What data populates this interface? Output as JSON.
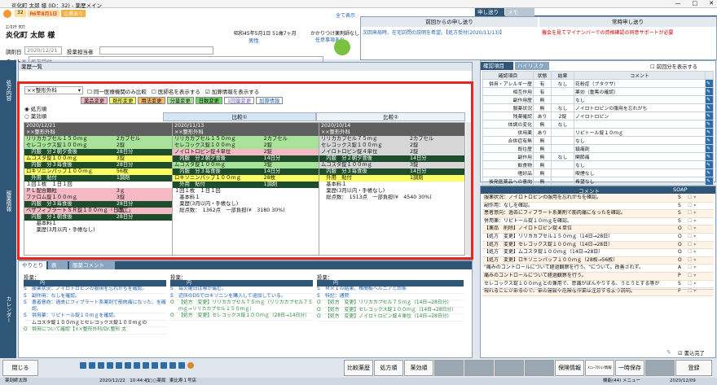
{
  "window": {
    "title": "炎化町 太郎 様 (ID：32) - 薬歴メイン"
  },
  "header": {
    "id": "32",
    "date": "R6年8月1日",
    "badge": "公費あり",
    "kana": "ｴﾝｶﾏﾁ ﾀﾛｳ",
    "name": "炎化町 太郎 様",
    "dob": "昭和45年5月1日 51歳7ヶ月",
    "sex": "男性",
    "shared": "全て表示",
    "reception_date_label": "調剤日",
    "reception_date": "2020/12/21",
    "pharmacist_label": "投薬担当者",
    "title_label": "タイトル",
    "title_value": "処方受付",
    "family_doctor": "かかりつけ薬剤師なし",
    "ref_note": "任意事項あり"
  },
  "top_tabs": {
    "t1": "申し送り",
    "t2": "メモ"
  },
  "handover": {
    "prev_header": "前回からの申し送り",
    "prev_text": "次回来局時、在宅訪問の説明を希望。【処方受付(2020/11/13)】",
    "const_header": "常時申し送り",
    "const_text": "機会を見てマイナンバーでの資格確認の同意サポートが必要"
  },
  "sidebar": [
    "処方内容",
    "服薬情報",
    "カレンダー"
  ],
  "rx": {
    "panel_title": "薬歴一覧",
    "dept": "××整形外科",
    "cb1": "同一医療機関のみ比較",
    "cb2": "医師名を表示する",
    "cb3": "加算情報を表示する",
    "badges": [
      "薬品変更",
      "剤形変更",
      "用法変更",
      "分量変更",
      "日数変更",
      "1回量変更",
      "加算情報"
    ],
    "radio1": "処方順",
    "radio2": "薬効順",
    "compare1": "比較①",
    "compare2": "比較②"
  },
  "cols": [
    {
      "date": "2020/12/21",
      "clinic": "××整形外科",
      "rows": [
        {
          "c": "g",
          "t": "リリカカプセル１５０ｍｇ",
          "q": "2カプセル"
        },
        {
          "c": "g",
          "t": "セレコックス錠１００ｍｇ",
          "q": "2錠"
        },
        {
          "c": "dg",
          "t": "　内服　分２朝夕食後",
          "q": "28日分"
        },
        {
          "c": "y",
          "t": "ムコスタ錠１００ｍｇ",
          "q": "3錠"
        },
        {
          "c": "dg",
          "t": "　内服　分３毎食後",
          "q": "28日分"
        },
        {
          "c": "y",
          "t": "ロキソニンパップ１００ｍｇ",
          "q": "56枚"
        },
        {
          "c": "dg",
          "t": "　外用　貼付",
          "q": "1調剤"
        },
        {
          "c": "w",
          "t": "１回１枚　１日１回",
          "q": ""
        },
        {
          "c": "p",
          "t": "ＰＬ配合顆粒",
          "q": "3ｇ"
        },
        {
          "c": "p",
          "t": "ファロム錠１００ｍｇ",
          "q": "3錠"
        },
        {
          "c": "dg",
          "t": "　内服　分３毎食後",
          "q": "28日分"
        },
        {
          "c": "p",
          "t": "ベザフィブラートＳＲ錠１００ｍｇ「日医工」",
          "q": "1錠"
        },
        {
          "c": "dg",
          "t": "　内服　分１朝食後",
          "q": "28日分"
        },
        {
          "c": "w",
          "t": "　　基本料１",
          "q": ""
        },
        {
          "c": "w",
          "t": "　　薬歴(3月以内・手帳なし)",
          "q": ""
        }
      ]
    },
    {
      "date": "2020/11/13",
      "clinic": "××整形外科",
      "rows": [
        {
          "c": "g",
          "t": "リリカカプセル１５０ｍｇ",
          "q": "2カプセル"
        },
        {
          "c": "g",
          "t": "セレコックス錠１００ｍｇ",
          "q": "2錠"
        },
        {
          "c": "p",
          "t": "ノイロトロピン錠４単位",
          "q": "2錠"
        },
        {
          "c": "dg",
          "t": "　内服　分２朝夕食後",
          "q": "14日分"
        },
        {
          "c": "g",
          "t": "ムコスタ錠１００ｍｇ",
          "q": "3錠"
        },
        {
          "c": "dg",
          "t": "　内服　分３毎食後",
          "q": "14日分"
        },
        {
          "c": "y",
          "t": "ロキソニンパップ１００ｍｇ",
          "q": "28枚"
        },
        {
          "c": "dg",
          "t": "　外用　貼付",
          "q": "1調剤"
        },
        {
          "c": "w",
          "t": "１回１枚　１日１回",
          "q": ""
        },
        {
          "c": "w",
          "t": "　基本料１",
          "q": ""
        },
        {
          "c": "w",
          "t": "　薬歴(3月以内・手帳なし)",
          "q": ""
        },
        {
          "c": "w",
          "t": "　総点数：　1362点　一部負担(¥　3180 30%)",
          "q": ""
        }
      ]
    },
    {
      "date": "2020/10/14",
      "clinic": "××整形外科",
      "rows": [
        {
          "c": "gy",
          "t": "リリカカプセル７５ｍｇ",
          "q": "2カプセル"
        },
        {
          "c": "gy",
          "t": "セレコックス錠１００ｍｇ",
          "q": "2錠"
        },
        {
          "c": "gy",
          "t": "ノイロトロピン錠４単位",
          "q": "2錠"
        },
        {
          "c": "dg",
          "t": "　内服　分２朝夕食後",
          "q": "14日分"
        },
        {
          "c": "gy",
          "t": "ムコスタ錠１００ｍｇ",
          "q": "3錠"
        },
        {
          "c": "dg",
          "t": "　内服　分３毎食後",
          "q": "14日分"
        },
        {
          "c": "y",
          "t": "　外用　貼付",
          "q": "1調剤"
        },
        {
          "c": "w",
          "t": "　基本料１",
          "q": ""
        },
        {
          "c": "w",
          "t": "　薬歴(3月以内・手帳なし)",
          "q": ""
        },
        {
          "c": "w",
          "t": "　総点数：　1513点　一部負担(¥　4540 30%)",
          "q": ""
        }
      ]
    }
  ],
  "bottom": {
    "tabs": [
      "やりとり",
      "表",
      "服薬コメント"
    ],
    "label": "投薬：",
    "col_header": "内",
    "c1": [
      {
        "k": "S",
        "t": "服薬状況：ノイロトロピンの服用を忘れがちを確認。"
      },
      {
        "k": "S",
        "t": "副作用：なしを確認。"
      },
      {
        "k": "S",
        "t": "患者意向：過去にフィブラート系薬剤で筋肉痛になった。を確認。"
      },
      {
        "k": "S",
        "t": "併用薬：リピトール錠１０ｍｇを確認。"
      },
      {
        "k": "",
        "t": "ムコスタ錠１００ｍｇとセレコックス錠１００ｍｇの"
      },
      {
        "k": "O",
        "t": "併用について確認【××整形外科/Dr.整形 太"
      }
    ],
    "c2": [
      {
        "k": "S",
        "t": "毎火曜日は喉が痛む。"
      },
      {
        "k": "S",
        "t": "近所のDSでロキソニンを購入して追加している。"
      },
      {
        "k": "O",
        "t": "【処方　変更】リリカカプセル７５ｍｇ（リリカカプセル７５ｍｇ→リリカカプセル１５０ｍｇ）"
      },
      {
        "k": "O",
        "t": "【処方　変更】セレコックス錠１００ｍｇ（28日→14日分）"
      }
    ],
    "c3": [
      {
        "k": "S",
        "t": "ＭＲＩの結果、椎間板ヘルニアと診断"
      },
      {
        "k": "S",
        "t": "特記：通院"
      },
      {
        "k": "O",
        "t": "【処方　変更】リリカカプセル７５ｍｇ（14日→28日分）"
      },
      {
        "k": "O",
        "t": "【処方　変更】セレコックス錠１００ｍｇ（14日→28日分）"
      },
      {
        "k": "O",
        "t": "【処方　変更】ノイロトロピン錠４単位（14日→28日分）"
      }
    ]
  },
  "check": {
    "tabs": [
      "確認項目",
      "ハイリスク"
    ],
    "prev_label": "前回分を表示する",
    "h1": "確認項目",
    "h2": "状態",
    "h3": "結果",
    "h4": "コメント",
    "rows": [
      [
        "併用・アレルギー歴",
        "有",
        "なし",
        "花粉症（ブタクサ）"
      ],
      [
        "相互作用",
        "有",
        "",
        "薬効（重篤の確認）"
      ],
      [
        "副作用歴",
        "無",
        "",
        "なし"
      ],
      [
        "服薬状況",
        "無",
        "なし",
        "ノイロトロピンの服用を忘れがち"
      ],
      [
        "残薬確認",
        "あり",
        "2錠",
        "ノイロトロピン"
      ],
      [
        "体調の変化",
        "無",
        "なし",
        ""
      ],
      [
        "併用薬",
        "あり",
        "",
        "リピトール錠１０ｍｇ"
      ],
      [
        "合併症有無",
        "無",
        "",
        "なし"
      ],
      [
        "既往歴",
        "無",
        "",
        "鎮痛剤"
      ],
      [
        "副作用",
        "無",
        "なし",
        "関節痛"
      ],
      [
        "飲食物",
        "無",
        "",
        "なし"
      ],
      [
        "嗜好品",
        "無",
        "",
        "喫煙なし"
      ],
      [
        "後発医薬品への意向",
        "無",
        "",
        "希望なし"
      ],
      [
        "おくすり手帳",
        "無",
        "不要",
        "なし"
      ]
    ]
  },
  "comments": {
    "title": "コメント",
    "soap": "SOAP",
    "rows": [
      [
        "服薬状況：ノイロトロピンの服用を忘れがちを確認。",
        "S"
      ],
      [
        "副作用：なしを確認。",
        "S"
      ],
      [
        "患者意向：過去にフィブラート系薬剤で筋肉痛になったを確認。",
        "S"
      ],
      [
        "併用薬：リピトール錠１０ｍｇを確認。",
        "S"
      ],
      [
        "【薬品　削除】ノイロトロピン錠４単位",
        "O"
      ],
      [
        "【処方　変更】リリカカプセル１５０ｍｇ（14日→28日）",
        "O"
      ],
      [
        "【処方　変更】セレコックス錠１００ｍｇ（14日→28日）",
        "O"
      ],
      [
        "【処方　変更】ムコスタ錠１００ｍｇ（14日→28日）",
        "O"
      ],
      [
        "【処方　変更】ロキソニンパップ１００ｍｇ（28枚→56枚）",
        "O"
      ],
      [
        "\"痛みのコントロールについて経過観察を行う。\"について。改善されず。",
        "A"
      ],
      [
        "痛みのコントロールについて経過観察を行う。",
        "P"
      ],
      [
        "セレコックス錠１００ｍｇとの兼用で、意識がぼんやりする、うとうとする等が",
        "S"
      ],
      [
        "現れることがあるので、車の運転や危険な作業は注意するよう説明。",
        "P"
      ]
    ],
    "footer_label": "書込完了"
  },
  "footer": {
    "close": "閉じる",
    "f1": "比較薬歴",
    "f2": "処方順",
    "f3": "薬効順",
    "f4": "",
    "f5": "",
    "f6": "",
    "f7": "",
    "f8": "保険情報",
    "f9": "ﾒﾆｭｰｱｸｼｮﾝ情報",
    "f10": "一時保存",
    "f11": "",
    "f12": "登録",
    "fkeys": [
      "F1",
      "F2",
      "F3",
      "F4",
      "F5",
      "F6",
      "F7",
      "F8",
      "F9",
      "F10",
      "F11",
      "F12"
    ]
  },
  "status": {
    "user": "薬剤師太郎",
    "datetime": "2020/12/22　10:44:41",
    "shop": "○○○薬局",
    "addr": "東比寿１号店",
    "mode": "機能(44) メニュー",
    "date2": "2020/12/09"
  },
  "colors": {
    "accent": "#2f5577",
    "red": "#e8251f",
    "green": "#a9e39a",
    "pink": "#f5b9c4",
    "yellow": "#fbfd63"
  }
}
